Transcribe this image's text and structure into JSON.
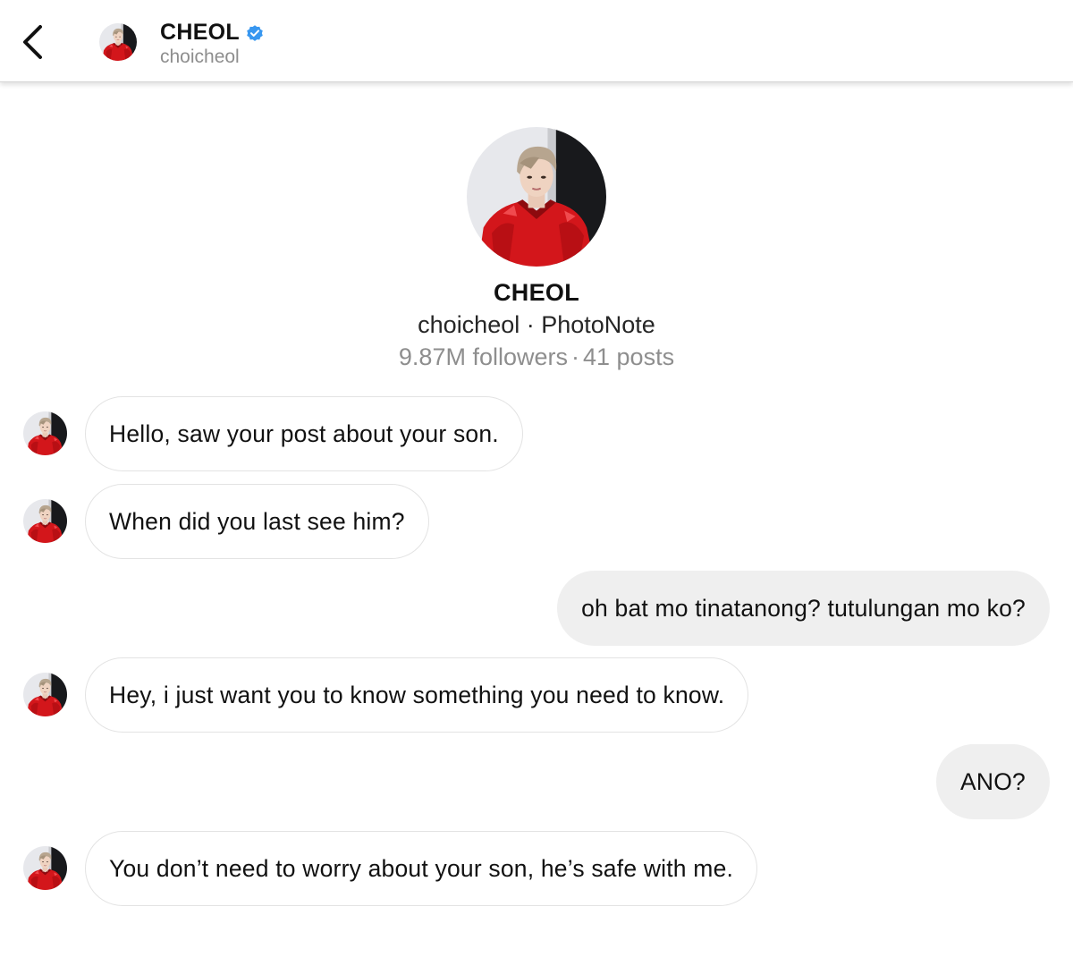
{
  "header": {
    "back_icon": "chevron-left-icon",
    "name": "CHEOL",
    "verified_icon": "verified-badge-icon",
    "handle": "choicheol"
  },
  "profile": {
    "name": "CHEOL",
    "subtitle": "choicheol · PhotoNote",
    "followers": "9.87M followers",
    "separator": "·",
    "posts": "41 posts"
  },
  "colors": {
    "verified": "#3897f0",
    "incoming_bubble_border": "#e3e3e3",
    "outgoing_bubble_bg": "#efefef",
    "secondary_text": "#8e8e8e"
  },
  "messages": [
    {
      "sender": "them",
      "text": "Hello, saw your post about your son."
    },
    {
      "sender": "them",
      "text": "When did you last see him?"
    },
    {
      "sender": "me",
      "text": "oh bat mo tinatanong? tutulungan mo ko?"
    },
    {
      "sender": "them",
      "text": "Hey, i just want you to know something you need to know."
    },
    {
      "sender": "me",
      "text": "ANO?"
    },
    {
      "sender": "them",
      "text": "You don’t need to worry about your son, he’s safe with me."
    }
  ]
}
